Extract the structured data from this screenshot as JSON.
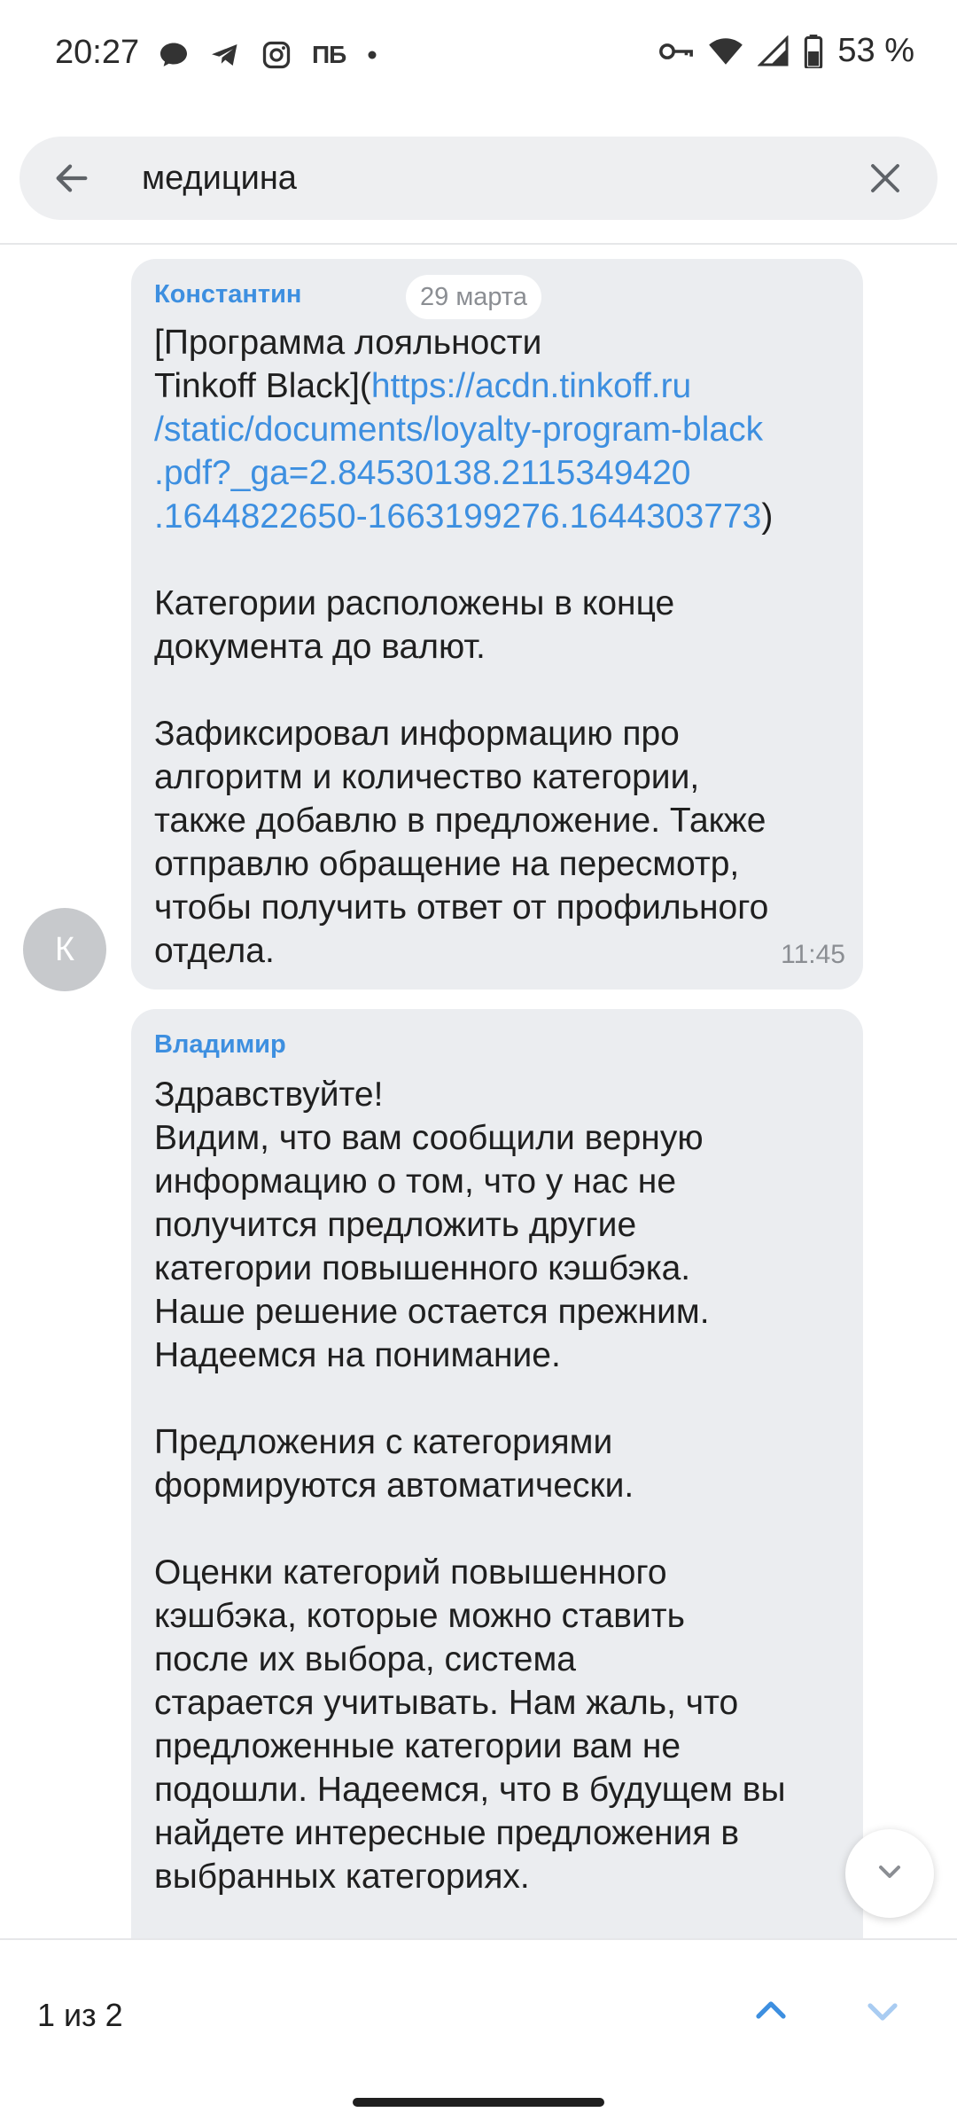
{
  "status_bar": {
    "time": "20:27",
    "battery": "53 %",
    "left_icons": [
      "message-bubble-icon",
      "telegram-icon",
      "instagram-icon",
      "pb-app-icon",
      "dot-icon"
    ],
    "pb_label": "ПБ",
    "right_icons": [
      "key-icon",
      "wifi-icon",
      "signal-icon",
      "battery-icon"
    ]
  },
  "search": {
    "query": "медицина",
    "back_icon": "arrow-left-icon",
    "clear_icon": "close-icon"
  },
  "messages": [
    {
      "author": "Константин",
      "date": "29 марта",
      "text_before_link": "[Программа лояльности\nTinkoff Black](",
      "link": "https://acdn.tinkoff.ru\n/static/documents/loyalty-program-black\n.pdf?_ga=2.84530138.2115349420\n.1644822650-1663199276.1644303773",
      "text_after_link": ")\n\nКатегории расположены в конце\nдокумента до валют.\n\nЗафиксировал информацию про\nалгоритм и количество категории,\nтакже добавлю в предложение. Также\nотправлю обращение на пересмотр,\nчтобы получить ответ от профильного\nотдела.",
      "time": "11:45",
      "avatar_letter": "К"
    },
    {
      "author": "Владимир",
      "text": "Здравствуйте!\nВидим, что вам сообщили верную\nинформацию о том, что у нас не\nполучится предложить другие\nкатегории повышенного кэшбэка.\nНаше решение остается прежним.\nНадеемся на понимание.\n\nПредложения с категориями\nформируются автоматически.\n\nОценки категорий повышенного\nкэшбэка, которые можно ставить\nпосле их выбора, система\nстарается учитывать. Нам жаль, что\nпредложенные категории вам не\nподошли. Надеемся, что в будущем вы\nнайдете интересные предложения в\nвыбранных категориях."
    }
  ],
  "bottom_nav": {
    "counter": "1 из 2",
    "prev_icon": "chevron-up-icon",
    "next_icon": "chevron-down-icon"
  },
  "scroll_down_icon": "chevron-down-icon",
  "colors": {
    "accent": "#3d8fe0",
    "bubble": "#ebedf0",
    "search_bg": "#eeeff1",
    "muted": "#8b8e93"
  }
}
